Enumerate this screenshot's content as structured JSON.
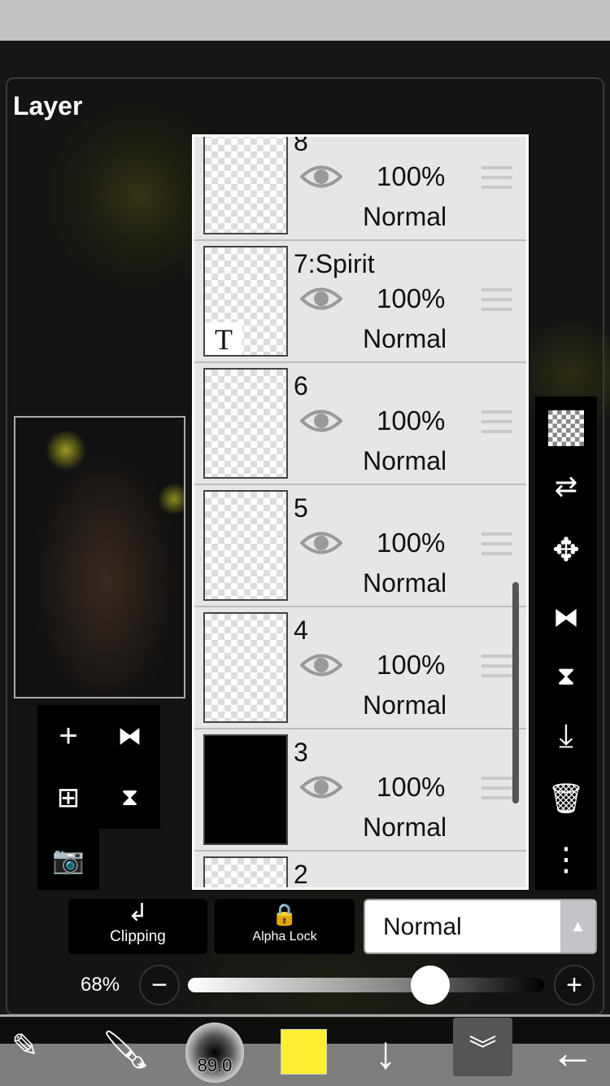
{
  "panel": {
    "title": "Layer"
  },
  "layers": [
    {
      "name": "8",
      "opacity": "100%",
      "mode": "Normal",
      "visible": true
    },
    {
      "name": "7:Spirit",
      "opacity": "100%",
      "mode": "Normal",
      "visible": true,
      "text_layer": "T"
    },
    {
      "name": "6",
      "opacity": "100%",
      "mode": "Normal",
      "visible": true
    },
    {
      "name": "5",
      "opacity": "100%",
      "mode": "Normal",
      "visible": true
    },
    {
      "name": "4",
      "opacity": "100%",
      "mode": "Normal",
      "visible": true
    },
    {
      "name": "3",
      "opacity": "100%",
      "mode": "Normal",
      "visible": true
    },
    {
      "name": "2"
    }
  ],
  "controls": {
    "clipping": "Clipping",
    "alpha_lock": "Alpha Lock",
    "blend_mode": "Normal",
    "opacity_label": "68%",
    "opacity_value": 0.68
  },
  "toolbar": {
    "brush_size": "89.0",
    "color": "#ffee33"
  }
}
